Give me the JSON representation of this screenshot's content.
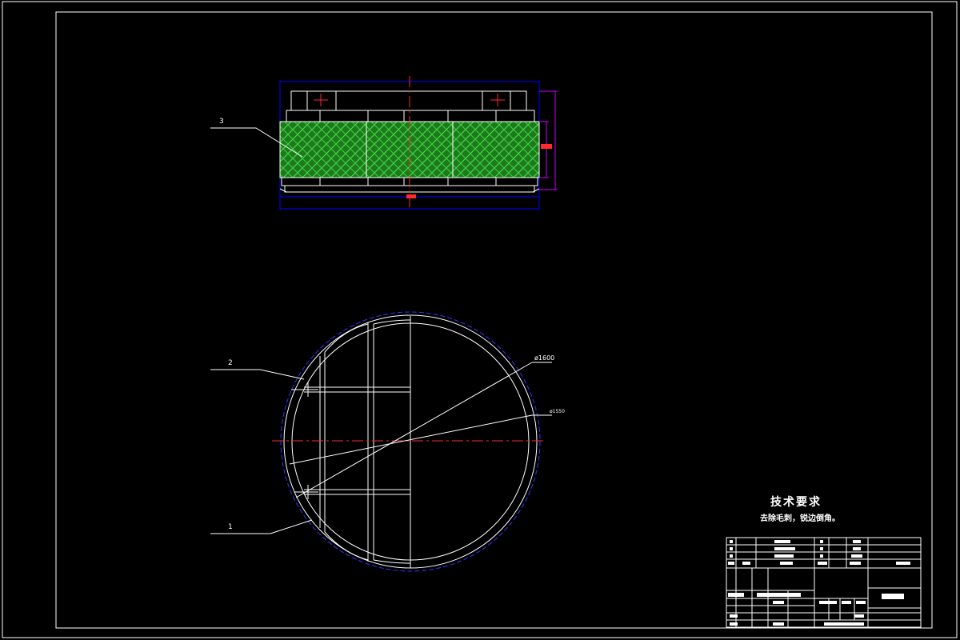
{
  "drawing": {
    "part_labels": {
      "callout_1": "1",
      "callout_2": "2",
      "callout_3": "3"
    },
    "dimensions": {
      "outer_diameter": "ø1600",
      "inner_diameter": "ø1550"
    },
    "colors": {
      "background": "#000000",
      "outline": "#ffffff",
      "dimension": "#0000ff",
      "centerline": "#ff0000",
      "hatch": "#22c322"
    }
  },
  "technical_requirements": {
    "title": "技术要求",
    "text": "去除毛刺，锐边倒角。"
  }
}
